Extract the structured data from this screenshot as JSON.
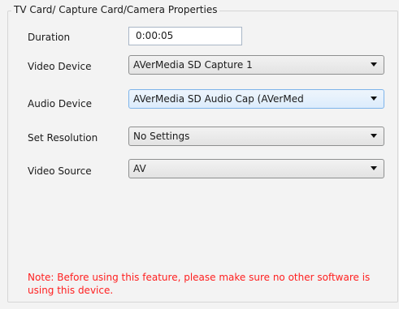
{
  "group": {
    "title": "TV Card/ Capture Card/Camera  Properties"
  },
  "fields": {
    "duration": {
      "label": "Duration",
      "value": "0:00:05"
    },
    "video_device": {
      "label": "Video Device",
      "value": "AVerMedia SD Capture 1"
    },
    "audio_device": {
      "label": "Audio Device",
      "value": "AVerMedia SD Audio Cap (AVerMed"
    },
    "resolution": {
      "label": "Set Resolution",
      "value": "No Settings"
    },
    "video_source": {
      "label": "Video Source",
      "value": "AV"
    }
  },
  "note": "Note: Before using this feature, please make sure no other software is using this device.",
  "icons": {
    "dropdown": "chevron-down-icon"
  },
  "colors": {
    "note_text": "#ff2020",
    "focus_border": "#7eb4ea"
  }
}
